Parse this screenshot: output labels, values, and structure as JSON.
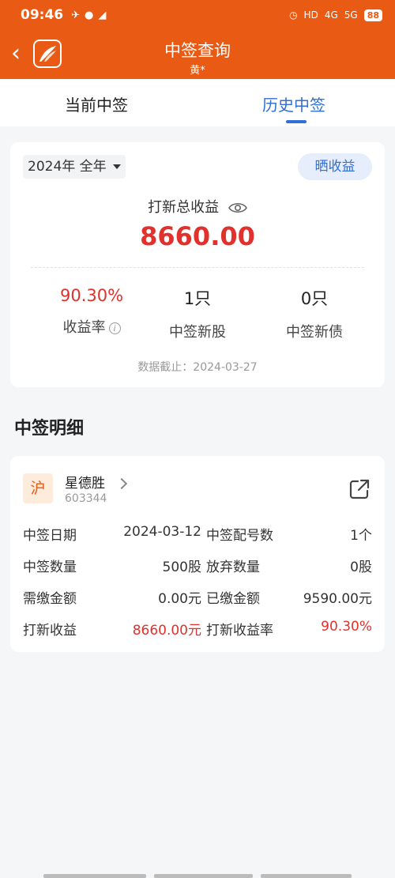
{
  "status_bar": {
    "time": "09:46",
    "network_left": "HD",
    "net1": "4G",
    "net2": "5G",
    "battery": "88"
  },
  "header": {
    "title": "中签查询",
    "subtitle": "黄*"
  },
  "tabs": [
    {
      "label": "当前中签",
      "active": false
    },
    {
      "label": "历史中签",
      "active": true
    }
  ],
  "summary": {
    "period": "2024年 全年",
    "share_label": "晒收益",
    "total_label": "打新总收益",
    "total_value": "8660.00",
    "stats": [
      {
        "value": "90.30%",
        "label": "收益率"
      },
      {
        "value": "1只",
        "label": "中签新股"
      },
      {
        "value": "0只",
        "label": "中签新债"
      }
    ],
    "cutoff": "数据截止：2024-03-27"
  },
  "detail_section": {
    "title": "中签明细"
  },
  "record": {
    "market": "沪",
    "name": "星德胜",
    "code": "603344",
    "rows": [
      {
        "k1": "中签日期",
        "v1": "2024-03-12",
        "k2": "中签配号数",
        "v2": "1个"
      },
      {
        "k1": "中签数量",
        "v1": "500股",
        "k2": "放弃数量",
        "v2": "0股"
      },
      {
        "k1": "需缴金额",
        "v1": "0.00元",
        "k2": "已缴金额",
        "v2": "9590.00元"
      },
      {
        "k1": "打新收益",
        "v1": "8660.00元",
        "k2": "打新收益率",
        "v2": "90.30%"
      }
    ]
  },
  "colors": {
    "brand": "#e95a14",
    "accent_blue": "#2f6fd6",
    "profit_red": "#e0312c"
  }
}
